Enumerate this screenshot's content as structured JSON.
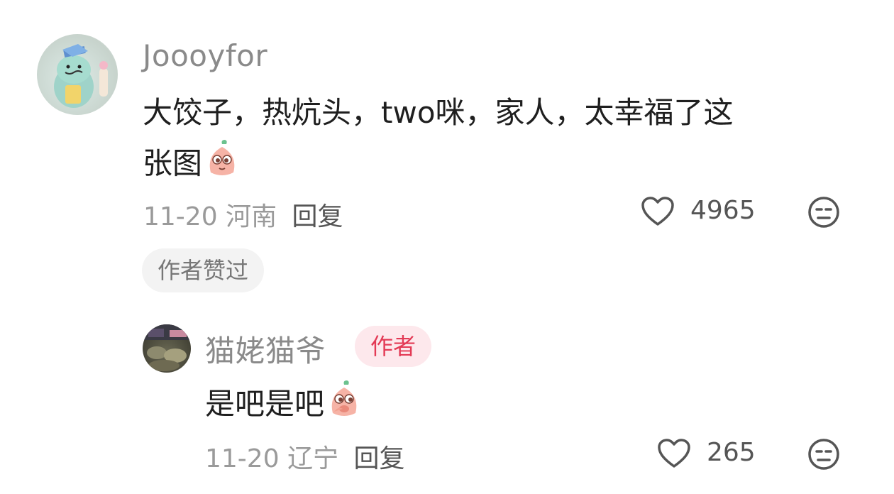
{
  "comment": {
    "author": "Joooyfor",
    "text_line1": "大饺子，热炕头，two咪，家人，太幸福了这",
    "text_line2": "张图",
    "emoji_icon": "shy-peach-emoji",
    "date": "11-20",
    "location": "河南",
    "reply_label": "回复",
    "like_count": "4965",
    "liked_by_author_chip": "作者赞过"
  },
  "reply": {
    "author": "猫姥猫爷",
    "author_badge": "作者",
    "text": "是吧是吧",
    "emoji_icon": "giggling-peach-emoji",
    "date": "11-20",
    "location": "辽宁",
    "reply_label": "回复",
    "like_count": "265"
  },
  "colors": {
    "badge_text": "#e33a55",
    "badge_bg": "#fde8ec",
    "meta_text": "#9a9a9a",
    "chip_bg": "#f3f3f3"
  }
}
